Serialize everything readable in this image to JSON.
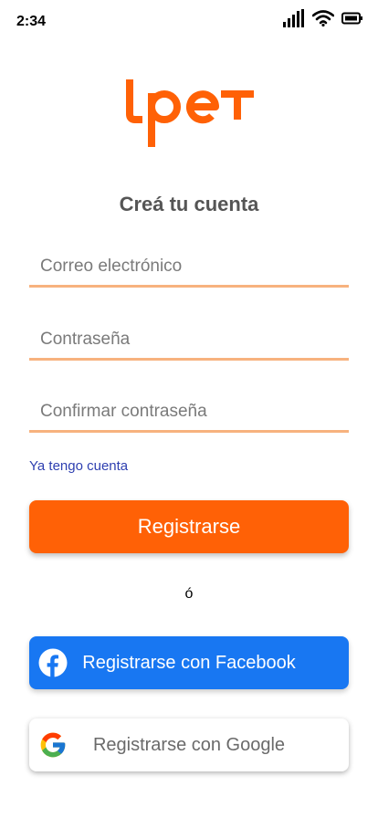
{
  "status_bar": {
    "time": "2:34",
    "icons": [
      "signal-icon",
      "wifi-icon",
      "battery-icon"
    ]
  },
  "logo": {
    "text": "lpet",
    "color": "#FF6106"
  },
  "heading": "Creá tu cuenta",
  "form": {
    "email": {
      "placeholder": "Correo electrónico",
      "value": ""
    },
    "password": {
      "placeholder": "Contraseña",
      "value": ""
    },
    "confirm_password": {
      "placeholder": "Confirmar contraseña",
      "value": ""
    },
    "field_underline_color": "#F7B27E"
  },
  "login_link": "Ya tengo cuenta",
  "register_button": {
    "label": "Registrarse",
    "color": "#FF6106"
  },
  "or_separator": "ó",
  "facebook_button": {
    "label": "Registrarse con Facebook",
    "icon": "facebook-icon",
    "color": "#1877F2"
  },
  "google_button": {
    "label": "Registrarse con Google",
    "icon": "google-icon",
    "color": "#FFFFFF"
  }
}
